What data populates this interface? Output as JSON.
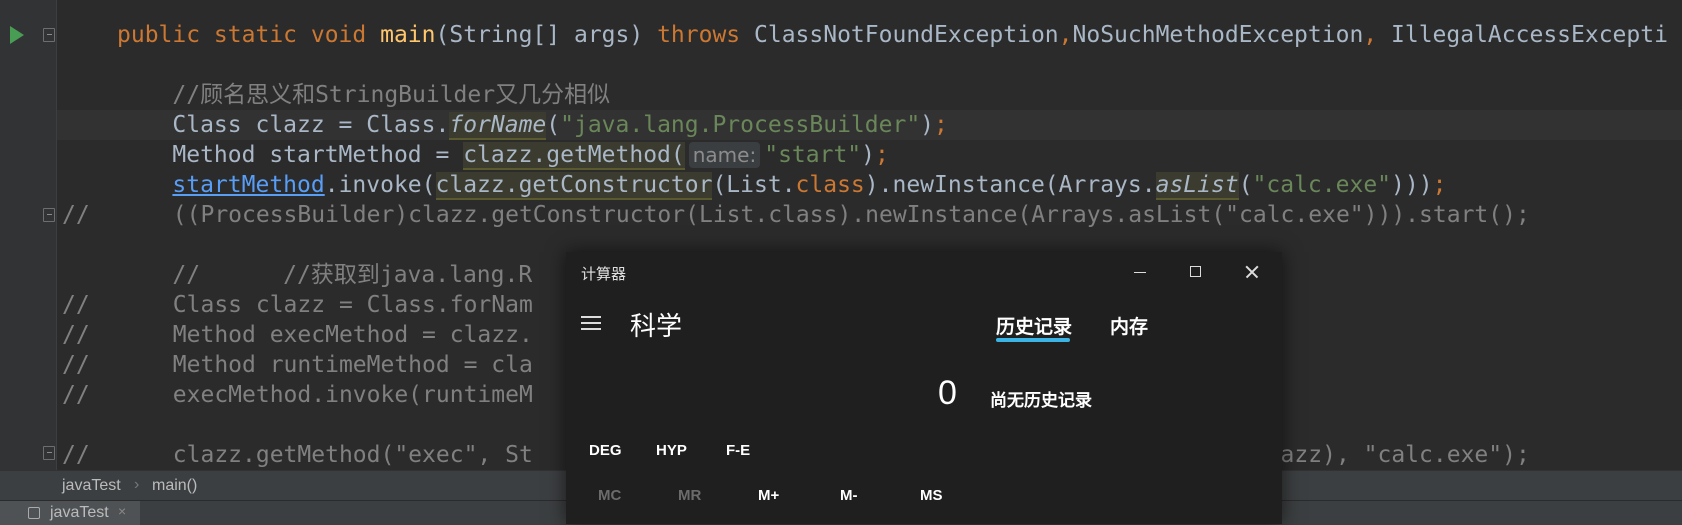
{
  "editor": {
    "lines": [
      [
        {
          "t": "public static void ",
          "c": "kw"
        },
        {
          "t": "main",
          "c": "fn"
        },
        {
          "t": "(String[] args) ",
          "c": ""
        },
        {
          "t": "throws ",
          "c": "kw"
        },
        {
          "t": "ClassNotFoundException",
          "c": ""
        },
        {
          "t": ",",
          "c": "kw"
        },
        {
          "t": "NoSuchMethodException",
          "c": ""
        },
        {
          "t": ", ",
          "c": "kw"
        },
        {
          "t": "IllegalAccessExcepti",
          "c": ""
        }
      ],
      [],
      [
        {
          "t": "    //顾名思义和StringBuilder又几分相似",
          "c": "cmt"
        }
      ],
      [
        {
          "t": "    Class clazz = Class.",
          "c": ""
        },
        {
          "t": "forName",
          "c": "it hl"
        },
        {
          "t": "(",
          "c": ""
        },
        {
          "t": "\"java.lang.ProcessBuilder\"",
          "c": "str"
        },
        {
          "t": ")",
          "c": ""
        },
        {
          "t": ";",
          "c": "kw"
        }
      ],
      [
        {
          "t": "    Method startMethod = ",
          "c": ""
        },
        {
          "t": "clazz.getMethod(",
          "c": "hl"
        },
        {
          "t": "name:",
          "c": "hint"
        },
        {
          "t": "\"start\"",
          "c": "str"
        },
        {
          "t": ")",
          "c": ""
        },
        {
          "t": ";",
          "c": "kw"
        }
      ],
      [
        {
          "t": "    ",
          "c": ""
        },
        {
          "t": "startMethod",
          "c": "link"
        },
        {
          "t": ".invoke(",
          "c": ""
        },
        {
          "t": "clazz.getConstructor",
          "c": "hl"
        },
        {
          "t": "(List.",
          "c": ""
        },
        {
          "t": "class",
          "c": "kw"
        },
        {
          "t": ").newInstance(Arrays.",
          "c": ""
        },
        {
          "t": "asList",
          "c": "it hl"
        },
        {
          "t": "(",
          "c": ""
        },
        {
          "t": "\"calc.exe\"",
          "c": "str"
        },
        {
          "t": ")))",
          "c": ""
        },
        {
          "t": ";",
          "c": "kw"
        }
      ],
      [
        {
          "t": "//      ((ProcessBuilder)clazz.getConstructor(List.class).newInstance(Arrays.asList(\"calc.exe\"))).start();",
          "c": "cmt"
        }
      ],
      [],
      [
        {
          "t": "    //      //获取到java.lang.R",
          "c": "cmt"
        }
      ],
      [
        {
          "t": "//      Class clazz = Class.forNam",
          "c": "cmt"
        }
      ],
      [
        {
          "t": "//      Method execMethod = clazz.",
          "c": "cmt"
        }
      ],
      [
        {
          "t": "//      Method runtimeMethod = cla",
          "c": "cmt"
        }
      ],
      [
        {
          "t": "//      execMethod.invoke(runtimeM",
          "c": "cmt"
        }
      ],
      [],
      [
        {
          "t": "//      clazz.getMethod(\"exec\", St                                               voke(clazz), \"calc.exe\");",
          "c": "cmt"
        }
      ]
    ]
  },
  "breadcrumb": {
    "items": [
      "javaTest",
      "main()"
    ],
    "separator": "›"
  },
  "file_tab": {
    "label": "javaTest",
    "close": "×"
  },
  "calculator": {
    "title": "计算器",
    "mode": "科学",
    "tabs": [
      "历史记录",
      "内存"
    ],
    "display": "0",
    "no_history": "尚无历史记录",
    "functions": [
      "DEG",
      "HYP",
      "F-E"
    ],
    "memory": [
      {
        "label": "MC",
        "enabled": false
      },
      {
        "label": "MR",
        "enabled": false
      },
      {
        "label": "M+",
        "enabled": true
      },
      {
        "label": "M-",
        "enabled": true
      },
      {
        "label": "MS",
        "enabled": true
      }
    ],
    "accent_color": "#3bb4e5"
  }
}
